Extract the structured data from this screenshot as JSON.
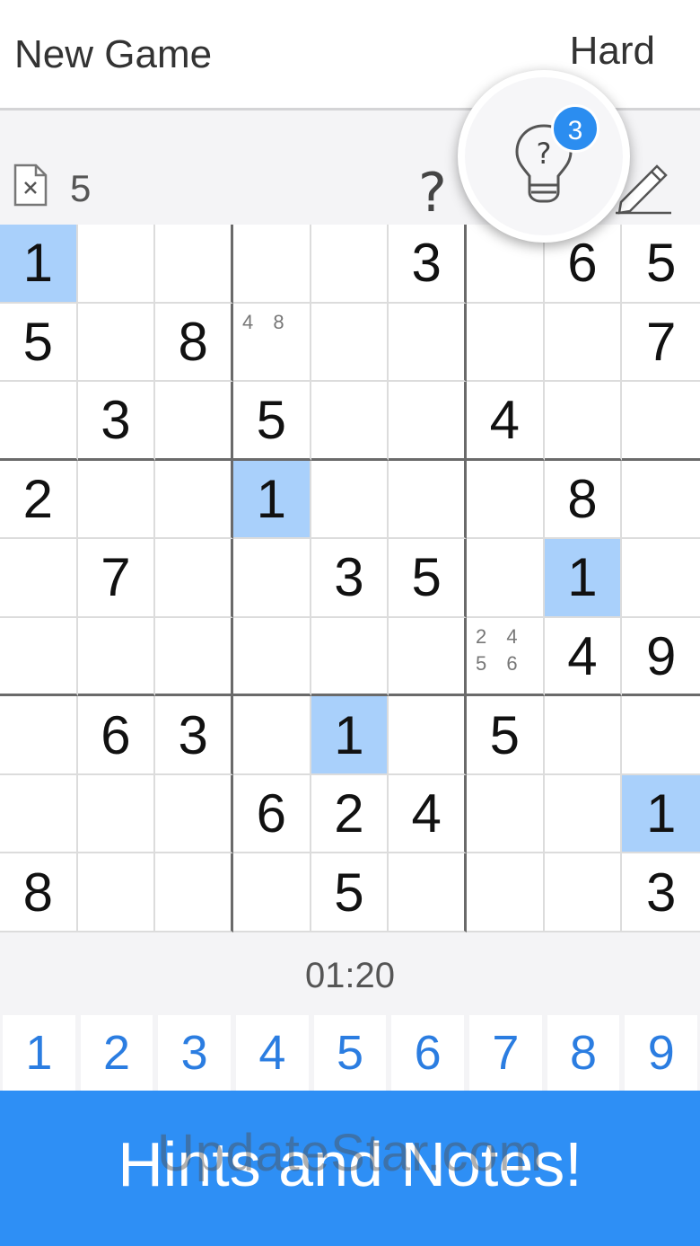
{
  "header": {
    "new_game_label": "New Game",
    "difficulty": "Hard"
  },
  "toolbar": {
    "mistakes": "5",
    "help_label": "?",
    "hint_count": "3"
  },
  "grid": {
    "rows": [
      [
        {
          "v": "1",
          "sel": true
        },
        {
          "v": ""
        },
        {
          "v": ""
        },
        {
          "v": ""
        },
        {
          "v": ""
        },
        {
          "v": "3"
        },
        {
          "v": ""
        },
        {
          "v": "6"
        },
        {
          "v": "5"
        }
      ],
      [
        {
          "v": "5"
        },
        {
          "v": ""
        },
        {
          "v": "8"
        },
        {
          "v": "",
          "note": "4 8"
        },
        {
          "v": ""
        },
        {
          "v": ""
        },
        {
          "v": ""
        },
        {
          "v": ""
        },
        {
          "v": "7"
        }
      ],
      [
        {
          "v": ""
        },
        {
          "v": "3"
        },
        {
          "v": ""
        },
        {
          "v": "5"
        },
        {
          "v": ""
        },
        {
          "v": ""
        },
        {
          "v": "4"
        },
        {
          "v": ""
        },
        {
          "v": ""
        }
      ],
      [
        {
          "v": "2"
        },
        {
          "v": ""
        },
        {
          "v": ""
        },
        {
          "v": "1",
          "sel": true
        },
        {
          "v": ""
        },
        {
          "v": ""
        },
        {
          "v": ""
        },
        {
          "v": "8"
        },
        {
          "v": ""
        }
      ],
      [
        {
          "v": ""
        },
        {
          "v": "7"
        },
        {
          "v": ""
        },
        {
          "v": ""
        },
        {
          "v": "3"
        },
        {
          "v": "5"
        },
        {
          "v": ""
        },
        {
          "v": "1",
          "sel": true
        },
        {
          "v": ""
        }
      ],
      [
        {
          "v": ""
        },
        {
          "v": ""
        },
        {
          "v": ""
        },
        {
          "v": ""
        },
        {
          "v": ""
        },
        {
          "v": ""
        },
        {
          "v": "",
          "note": "2 4 5 6"
        },
        {
          "v": "4"
        },
        {
          "v": "9"
        }
      ],
      [
        {
          "v": ""
        },
        {
          "v": "6"
        },
        {
          "v": "3"
        },
        {
          "v": ""
        },
        {
          "v": "1",
          "sel": true
        },
        {
          "v": ""
        },
        {
          "v": "5"
        },
        {
          "v": ""
        },
        {
          "v": ""
        }
      ],
      [
        {
          "v": ""
        },
        {
          "v": ""
        },
        {
          "v": ""
        },
        {
          "v": "6"
        },
        {
          "v": "2"
        },
        {
          "v": "4"
        },
        {
          "v": ""
        },
        {
          "v": ""
        },
        {
          "v": "1",
          "sel": true
        }
      ],
      [
        {
          "v": "8"
        },
        {
          "v": ""
        },
        {
          "v": ""
        },
        {
          "v": ""
        },
        {
          "v": "5"
        },
        {
          "v": ""
        },
        {
          "v": ""
        },
        {
          "v": ""
        },
        {
          "v": "3"
        }
      ]
    ]
  },
  "timer": "01:20",
  "numpad": [
    "1",
    "2",
    "3",
    "4",
    "5",
    "6",
    "7",
    "8",
    "9"
  ],
  "banner": {
    "text": "Hints and Notes!",
    "watermark": "UpdateStar.com"
  },
  "colors": {
    "accent": "#2e8ff5",
    "selected_cell": "#a9d0fb",
    "number_key": "#2b7de1"
  }
}
